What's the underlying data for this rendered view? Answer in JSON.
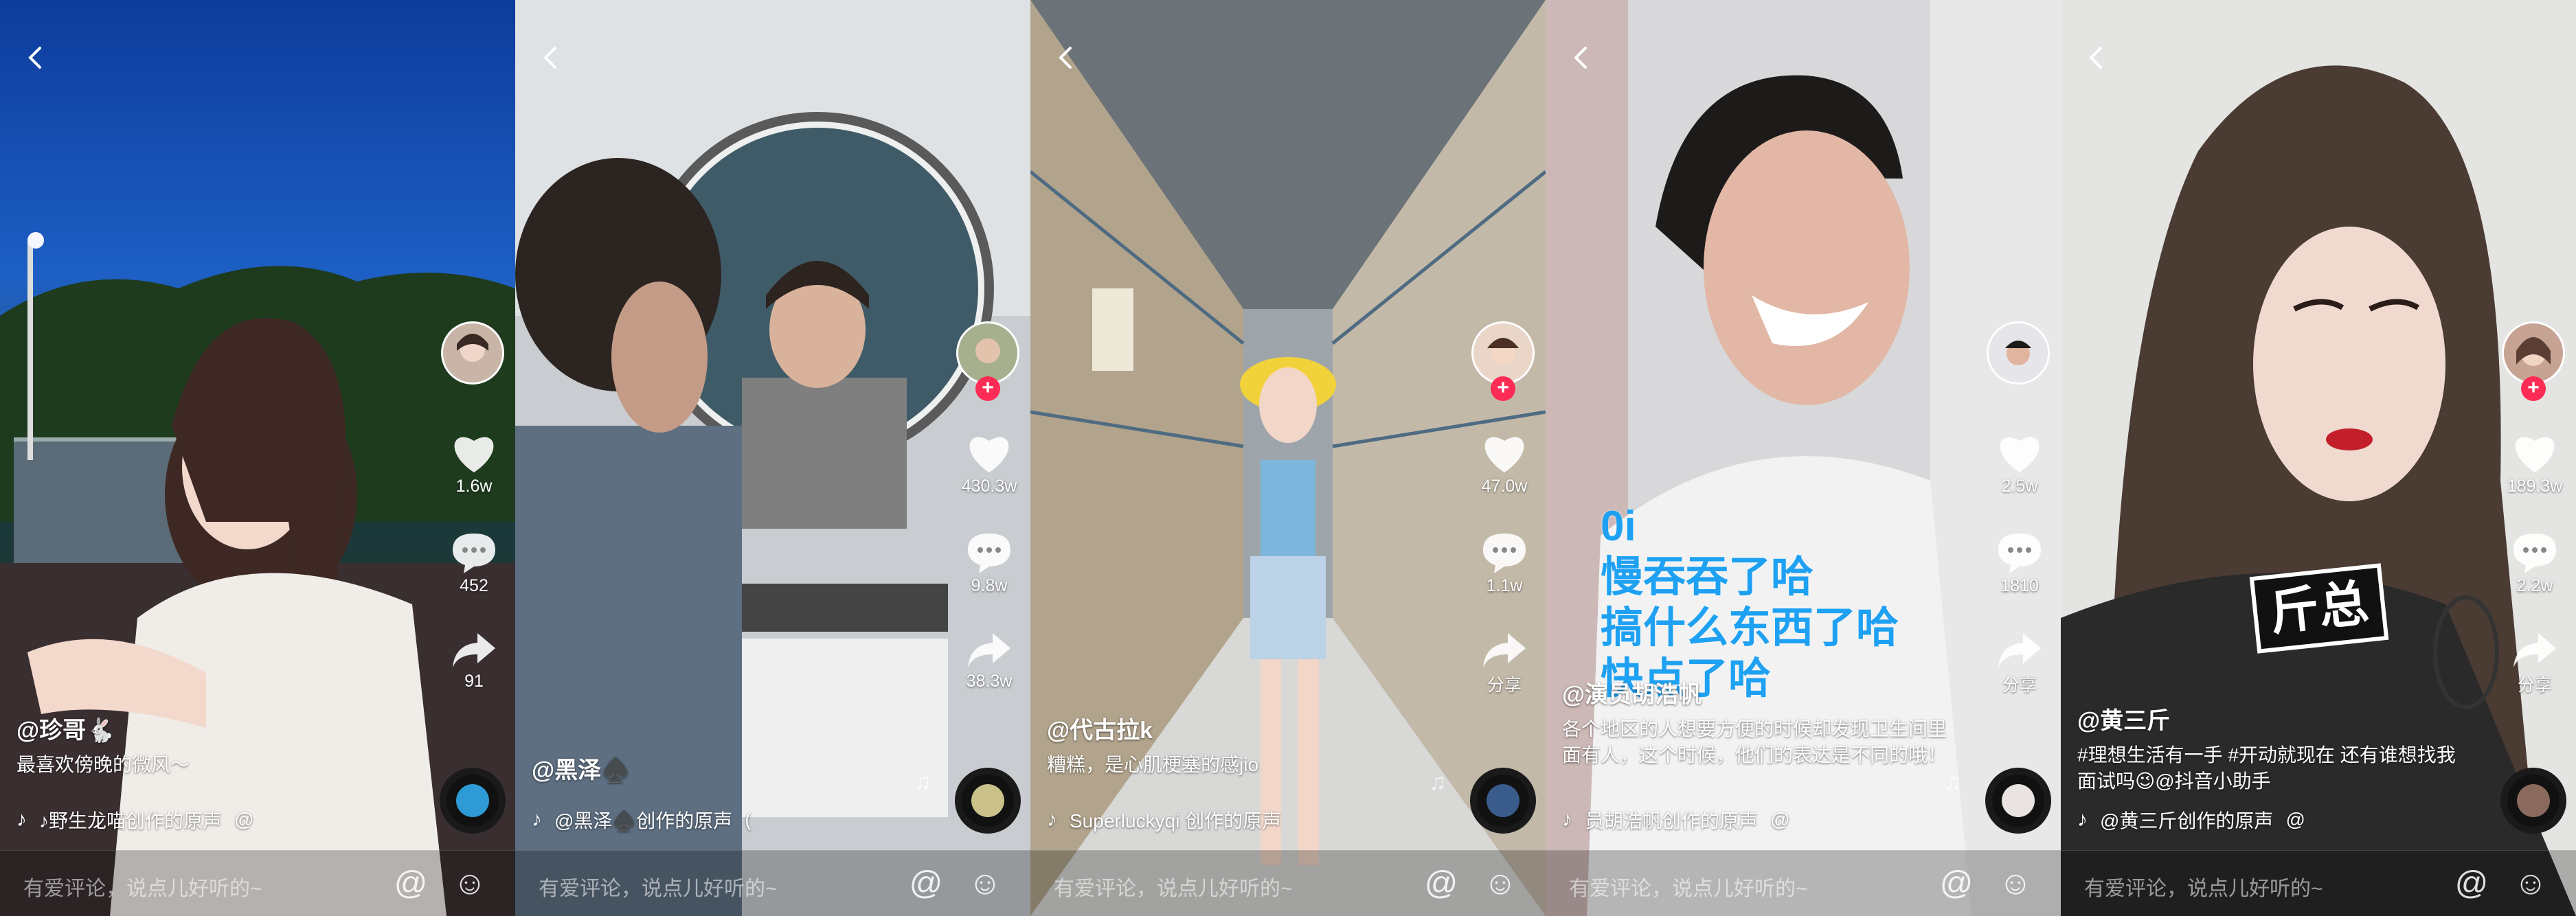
{
  "screens": [
    {
      "avatar_hint": "avatar",
      "likes": "1.6w",
      "comments": "452",
      "shares": "91",
      "handle": "@珍哥🐇",
      "caption": "最喜欢傍晚的微风～",
      "music": "♪野生龙喵创作的原声",
      "music_tail": "@",
      "comment_placeholder": "有爱评论，说点儿好听的~",
      "show_follow": false,
      "share_label": ""
    },
    {
      "likes": "430.3w",
      "comments": "9.8w",
      "shares": "38.3w",
      "handle": "@黑泽♠️",
      "caption": "",
      "music": "@黑泽♠️创作的原声",
      "music_tail": "(",
      "comment_placeholder": "有爱评论，说点儿好听的~",
      "show_follow": true,
      "share_label": ""
    },
    {
      "likes": "47.0w",
      "comments": "1.1w",
      "shares": "",
      "handle": "@代古拉k",
      "caption": "糟糕，是心肌梗塞的感jio",
      "music": "Superluckyqi 创作的原声",
      "music_tail": "",
      "comment_placeholder": "有爱评论，说点儿好听的~",
      "show_follow": true,
      "share_label": "分享"
    },
    {
      "likes": "2.5w",
      "comments": "1810",
      "shares": "",
      "handle": "@演员胡浩帆",
      "caption": "各个地区的人想要方便的时候却发现卫生间里面有人，这个时候，他们的表达是不同的哦！",
      "music": "员胡浩帆创作的原声",
      "music_tail": "@",
      "comment_placeholder": "有爱评论，说点儿好听的~",
      "show_follow": false,
      "share_label": "分享",
      "overlay_lines": [
        "0i",
        "慢吞吞了哈",
        "搞什么东西了哈",
        "快点了哈"
      ]
    },
    {
      "likes": "189.3w",
      "comments": "2.2w",
      "shares": "",
      "handle": "@黄三斤",
      "caption": "#理想生活有一手 #开动就现在 还有谁想找我面试吗😉@抖音小助手",
      "music": "@黄三斤创作的原声",
      "music_tail": "@",
      "comment_placeholder": "有爱评论，说点儿好听的~",
      "show_follow": true,
      "share_label": "分享",
      "sticker": "斤总"
    }
  ],
  "colors": {
    "follow_plus": "#fe2c55",
    "overlay_blue": "#1ea1f2"
  }
}
